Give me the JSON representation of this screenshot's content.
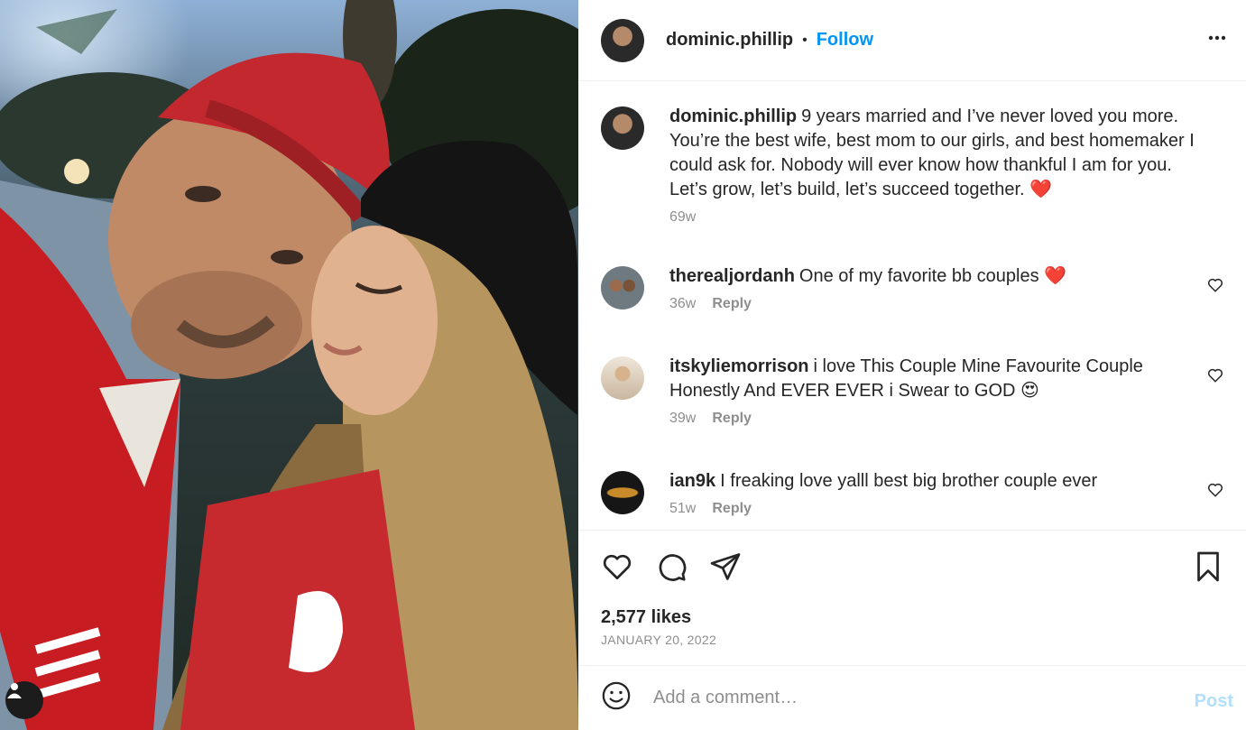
{
  "header": {
    "username": "dominic.phillip",
    "separator": "•",
    "follow_label": "Follow"
  },
  "caption": {
    "username": "dominic.phillip",
    "text": "9 years married and I’ve never loved you more. You’re the best wife, best mom to our girls, and best homemaker I could ask for. Nobody will ever know how thankful I am for you. Let’s grow, let’s build, let’s succeed together. ❤️",
    "age": "69w"
  },
  "comments": [
    {
      "username": "therealjordanh",
      "text": "One of my favorite bb couples ❤️",
      "age": "36w",
      "reply_label": "Reply"
    },
    {
      "username": "itskyliemorrison",
      "text": "i love This Couple Mine Favourite Couple Honestly And EVER EVER i Swear to GOD 😍",
      "age": "39w",
      "reply_label": "Reply"
    },
    {
      "username": "ian9k",
      "text": "I freaking love yalll best big brother couple ever",
      "age": "51w",
      "reply_label": "Reply"
    }
  ],
  "stats": {
    "likes": "2,577 likes",
    "date": "JANUARY 20, 2022"
  },
  "composer": {
    "placeholder": "Add a comment…",
    "post_label": "Post"
  },
  "icons": {
    "more": "more-options-icon",
    "like": "heart-icon",
    "comment": "comment-bubble-icon",
    "share": "paper-plane-icon",
    "save": "bookmark-icon",
    "emoji": "smiley-icon",
    "tags": "user-tag-icon"
  },
  "colors": {
    "accent": "#0095f6",
    "post_disabled": "#b2dffc",
    "muted": "#8e8e8e",
    "text": "#262626"
  }
}
